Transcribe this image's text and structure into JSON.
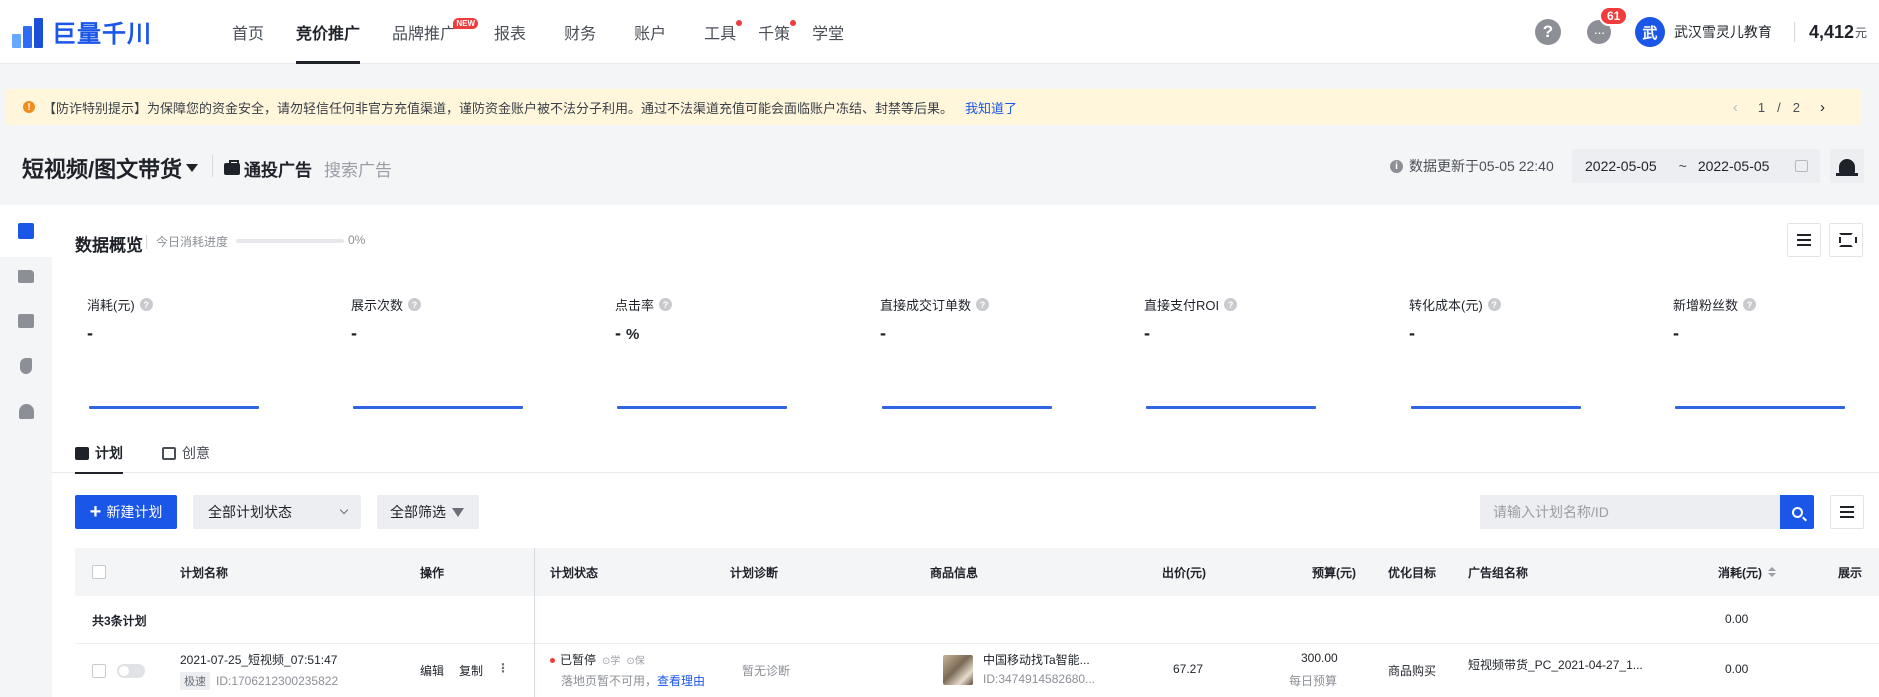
{
  "brand": {
    "name": "巨量千川"
  },
  "nav": {
    "items": [
      {
        "label": "首页",
        "active": false
      },
      {
        "label": "竞价推广",
        "active": true
      },
      {
        "label": "品牌推广",
        "badge": "NEW"
      },
      {
        "label": "报表"
      },
      {
        "label": "财务"
      },
      {
        "label": "账户"
      },
      {
        "label": "工具",
        "dot": true
      },
      {
        "label": "千策",
        "dot": true
      },
      {
        "label": "学堂"
      }
    ]
  },
  "header_right": {
    "help": "?",
    "message_count": "61",
    "avatar_char": "武",
    "account_name": "武汉雪灵儿教育",
    "balance": "4,412",
    "balance_unit": "元"
  },
  "notice": {
    "icon": "!",
    "text": "【防诈特别提示】为保障您的资金安全，请勿轻信任何非官方充值渠道，谨防资金账户被不法分子利用。通过不法渠道充值可能会面临账户冻结、封禁等后果。",
    "link": "我知道了",
    "page_current": "1",
    "page_sep": "/",
    "page_total": "2",
    "prev": "‹",
    "next": "›"
  },
  "page": {
    "title": "短视频/图文带货",
    "tabs": [
      {
        "label": "通投广告",
        "active": true
      },
      {
        "label": "搜索广告",
        "active": false
      }
    ],
    "update_info": "数据更新于05-05 22:40",
    "date_start": "2022-05-05",
    "date_tilde": "~",
    "date_end": "2022-05-05"
  },
  "overview": {
    "title": "数据概览",
    "progress_label": "今日消耗进度",
    "progress_value": 0,
    "progress_text": "0%",
    "metrics": [
      {
        "label": "消耗(元)",
        "value": "-"
      },
      {
        "label": "展示次数",
        "value": "-"
      },
      {
        "label": "点击率",
        "value": "-",
        "unit": "%"
      },
      {
        "label": "直接成交订单数",
        "value": "-"
      },
      {
        "label": "直接支付ROI",
        "value": "-"
      },
      {
        "label": "转化成本(元)",
        "value": "-"
      },
      {
        "label": "新增粉丝数",
        "value": "-"
      }
    ]
  },
  "list_tabs": [
    {
      "label": "计划",
      "active": true
    },
    {
      "label": "创意",
      "active": false
    }
  ],
  "toolbar": {
    "new_plan": "新建计划",
    "plus": "+",
    "status_select": "全部计划状态",
    "filter": "全部筛选",
    "search_placeholder": "请输入计划名称/ID"
  },
  "table": {
    "columns": {
      "name": "计划名称",
      "ops": "操作",
      "status": "计划状态",
      "diag": "计划诊断",
      "product": "商品信息",
      "bid": "出价(元)",
      "budget": "预算(元)",
      "goal": "优化目标",
      "group": "广告组名称",
      "cost": "消耗(元)",
      "show": "展示"
    },
    "summary": {
      "label": "共3条计划",
      "cost": "0.00"
    },
    "rows": [
      {
        "name": "2021-07-25_短视频_07:51:47",
        "tag": "极速",
        "id": "ID:1706212300235822",
        "op_edit": "编辑",
        "op_copy": "复制",
        "op_more": "⋮",
        "status": "已暂停",
        "status_badge1": "⊙学",
        "status_badge2": "⊙保",
        "status_reason": "落地页暂不可用，",
        "status_link": "查看理由",
        "diag": "暂无诊断",
        "product_name": "中国移动找Ta智能...",
        "product_id": "ID:3474914582680...",
        "bid": "67.27",
        "budget": "300.00",
        "budget_type": "每日预算",
        "goal": "商品购买",
        "group": "短视频带货_PC_2021-04-27_1...",
        "cost": "0.00"
      }
    ]
  },
  "colors": {
    "primary": "#1a56e8",
    "notice_bg": "#fff6dc",
    "badge_red": "#f03c3c",
    "warn": "#f28c1b"
  }
}
